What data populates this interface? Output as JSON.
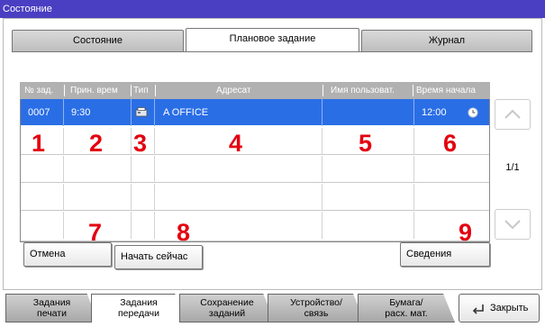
{
  "window": {
    "title": "Состояние"
  },
  "tabs": [
    {
      "label": "Состояние"
    },
    {
      "label": "Плановое задание"
    },
    {
      "label": "Журнал"
    }
  ],
  "table": {
    "headers": [
      "№ зад.",
      "Прин. врем",
      "Тип",
      "Адресат",
      "Имя пользоват.",
      "Время начала"
    ],
    "rows": [
      {
        "job": "0007",
        "received": "9:30",
        "type_icon": "fax-icon",
        "destination": "A OFFICE",
        "user": "",
        "start": "12:00"
      }
    ]
  },
  "callouts": [
    "1",
    "2",
    "3",
    "4",
    "5",
    "6",
    "7",
    "8",
    "9"
  ],
  "pagination": {
    "label": "1/1"
  },
  "buttons": {
    "cancel": "Отмена",
    "start_now": "Начать сейчас",
    "details": "Сведения"
  },
  "bottom_tabs": [
    {
      "line1": "Задания",
      "line2": "печати"
    },
    {
      "line1": "Задания",
      "line2": "передачи"
    },
    {
      "line1": "Сохранение",
      "line2": "заданий"
    },
    {
      "line1": "Устройство/",
      "line2": "связь"
    },
    {
      "line1": "Бумага/",
      "line2": "расх. мат."
    }
  ],
  "close_label": "Закрыть",
  "colors": {
    "title_bar": "#4a3ec2",
    "selected_row": "#2a6ee6",
    "callout": "#e3000f"
  }
}
